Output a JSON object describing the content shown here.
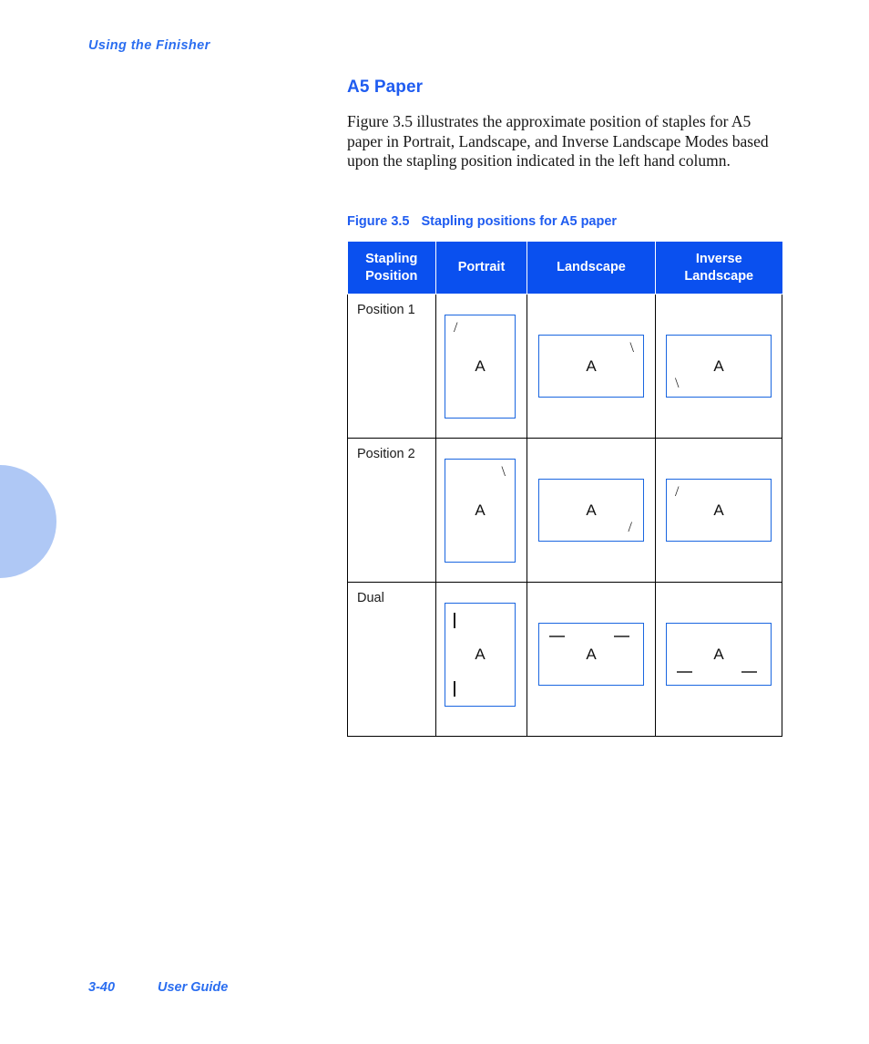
{
  "page": {
    "running_header": "Using the Finisher",
    "footer_page_number": "3-40",
    "footer_doc_title": "User Guide",
    "accent_color": "#1f5cf0",
    "table_header_color": "#0a50ef",
    "sheet_border_color": "#1a66e0",
    "deco_circle_color": "#afc8f5"
  },
  "section": {
    "title": "A5 Paper",
    "paragraph": "Figure 3.5 illustrates the approximate position of staples for A5 paper in Portrait, Landscape, and Inverse Landscape Modes based upon the stapling position indicated in the left hand column."
  },
  "figure": {
    "number": "Figure 3.5",
    "caption": "Stapling positions for A5 paper",
    "columns": [
      "Stapling Position",
      "Portrait",
      "Landscape",
      "Inverse Landscape"
    ],
    "header_lines": [
      [
        "Stapling",
        "Position"
      ],
      [
        "Portrait"
      ],
      [
        "Landscape"
      ],
      [
        "Inverse",
        "Landscape"
      ]
    ],
    "page_letter": "A",
    "rows": [
      {
        "position_label": "Position 1",
        "portrait": {
          "orientation": "portrait",
          "staple": "/",
          "staple_location": "top-left"
        },
        "landscape": {
          "orientation": "landscape",
          "staple": "\\",
          "staple_location": "top-right"
        },
        "inverse_landscape": {
          "orientation": "landscape",
          "staple": "\\",
          "staple_location": "bottom-left"
        }
      },
      {
        "position_label": "Position 2",
        "portrait": {
          "orientation": "portrait",
          "staple": "\\",
          "staple_location": "top-right"
        },
        "landscape": {
          "orientation": "landscape",
          "staple": "/",
          "staple_location": "bottom-right"
        },
        "inverse_landscape": {
          "orientation": "landscape",
          "staple": "/",
          "staple_location": "top-left"
        }
      },
      {
        "position_label": "Dual",
        "portrait": {
          "orientation": "portrait",
          "staple": "dual-vertical",
          "staple_location": "left-edge-top-and-bottom"
        },
        "landscape": {
          "orientation": "landscape",
          "staple": "dual-horizontal",
          "staple_location": "top-edge-left-and-right"
        },
        "inverse_landscape": {
          "orientation": "landscape",
          "staple": "dual-horizontal",
          "staple_location": "bottom-edge-left-and-right"
        }
      }
    ]
  }
}
